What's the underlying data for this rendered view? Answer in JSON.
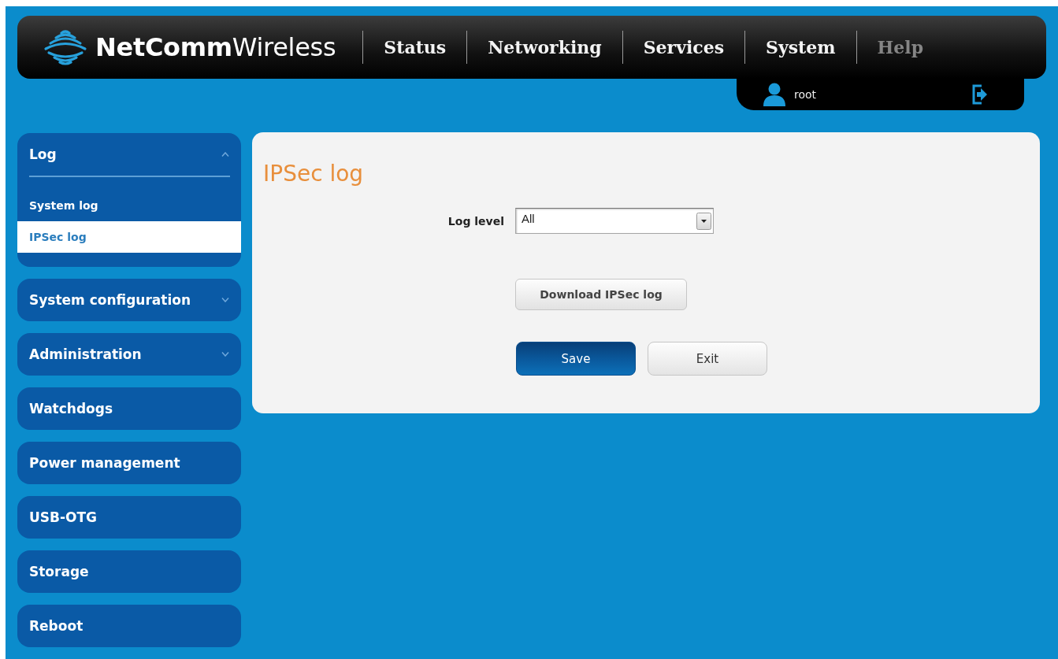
{
  "header": {
    "logo_text": "**NetComm**Wireless",
    "nav": [
      {
        "label": "Status",
        "disabled": false
      },
      {
        "label": "Networking",
        "disabled": false
      },
      {
        "label": "Services",
        "disabled": false
      },
      {
        "label": "System",
        "disabled": false
      },
      {
        "label": "Help",
        "disabled": true
      }
    ],
    "user": {
      "name": "root"
    }
  },
  "sidebar": {
    "groups": [
      {
        "label": "Log",
        "kind": "group",
        "expanded": true,
        "children": [
          {
            "label": "System log",
            "selected": false
          },
          {
            "label": "IPSec log",
            "selected": true
          }
        ]
      },
      {
        "label": "System configuration",
        "kind": "group",
        "expanded": false
      },
      {
        "label": "Administration",
        "kind": "group",
        "expanded": false
      },
      {
        "label": "Watchdogs",
        "kind": "link"
      },
      {
        "label": "Power management",
        "kind": "link"
      },
      {
        "label": "USB-OTG",
        "kind": "link"
      },
      {
        "label": "Storage",
        "kind": "link"
      },
      {
        "label": "Reboot",
        "kind": "link"
      }
    ]
  },
  "main": {
    "title": "IPSec log",
    "fields": [
      {
        "kind": "select",
        "label": "Log level",
        "value": "All"
      },
      {
        "kind": "button",
        "label": "Download IPSec log"
      }
    ],
    "actions": [
      {
        "label": "Save",
        "kind": "primary"
      },
      {
        "label": "Exit",
        "kind": "secondary"
      }
    ]
  }
}
